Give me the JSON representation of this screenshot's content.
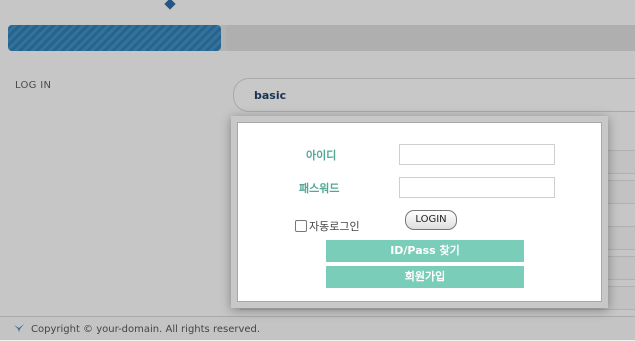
{
  "header": {
    "progress": 0.34
  },
  "section": {
    "heading": "LOG IN",
    "tab_label": "basic"
  },
  "modal": {
    "id_label": "아이디",
    "password_label": "패스워드",
    "id_value": "",
    "password_value": "",
    "auto_login_label": "자동로그인",
    "auto_login_checked": false,
    "login_button": "LOGIN",
    "find_button": "ID/Pass 찾기",
    "signup_button": "회원가입"
  },
  "footer": {
    "copyright": "Copyright © your-domain. All rights reserved."
  },
  "colors": {
    "accent": "#79cdb9",
    "label": "#52a894",
    "progress": "#3f8bbd"
  }
}
